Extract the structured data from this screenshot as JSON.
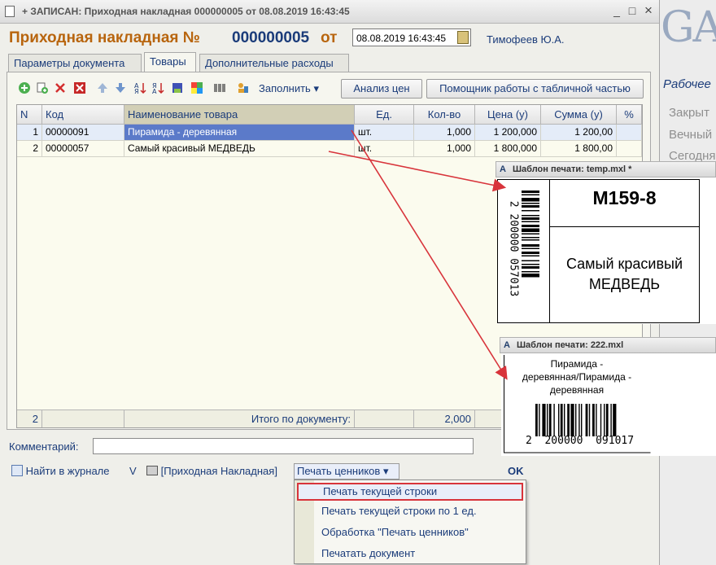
{
  "window": {
    "title": "+ ЗАПИСАН: Приходная накладная 000000005 от 08.08.2019 16:43:45",
    "minimize": "_",
    "maximize": "□",
    "close": "×"
  },
  "header": {
    "form_title": "Приходная накладная №",
    "number": "000000005",
    "from_label": "от",
    "date": "08.08.2019 16:43:45",
    "author": "Тимофеев Ю.А."
  },
  "tabs": [
    {
      "label": "Параметры документа",
      "active": false
    },
    {
      "label": "Товары",
      "active": true
    },
    {
      "label": "Дополнительные расходы",
      "active": false
    }
  ],
  "toolbar": {
    "fill_label": "Заполнить",
    "price_analysis_label": "Анализ цен",
    "table_helper_label": "Помощник работы с табличной частью",
    "icons": [
      "add-icon",
      "copy-icon",
      "delete-icon",
      "mark-delete-icon",
      "move-up-icon",
      "move-down-icon",
      "sort-asc-icon",
      "sort-desc-icon",
      "save-icon",
      "color-icon",
      "barcode-icon",
      "selection-icon"
    ]
  },
  "table": {
    "columns": [
      "N",
      "Код",
      "Наименование товара",
      "Ед.",
      "Кол-во",
      "Цена (у)",
      "Сумма (у)",
      "%"
    ],
    "rows": [
      {
        "n": "1",
        "code": "00000091",
        "name": "Пирамида - деревянная",
        "unit": "шт.",
        "qty": "1,000",
        "price": "1 200,000",
        "sum": "1 200,00",
        "pct": ""
      },
      {
        "n": "2",
        "code": "00000057",
        "name": "Самый красивый МЕДВЕДЬ",
        "unit": "шт.",
        "qty": "1,000",
        "price": "1 800,000",
        "sum": "1 800,00",
        "pct": ""
      }
    ],
    "footer": {
      "count": "2",
      "total_label": "Итого по документу:",
      "total_qty": "2,000"
    }
  },
  "comment": {
    "label": "Комментарий:",
    "value": ""
  },
  "bottom": {
    "journal_link": "Найти в журнале",
    "v_label": "V",
    "print_doc_link": "[Приходная Накладная]",
    "price_tags_menu": "Печать ценников",
    "ok_label": "OK"
  },
  "dropdown": {
    "items": [
      {
        "label": "Печать текущей строки",
        "highlighted": true
      },
      {
        "label": "Печать текущей строки по 1 ед.",
        "highlighted": false
      },
      {
        "label": "Обработка \"Печать ценников\"",
        "highlighted": false
      },
      {
        "label": "Печатать документ",
        "highlighted": false
      }
    ]
  },
  "template1": {
    "title": "Шаблон печати: temp.mxl *",
    "article": "М159-8",
    "name_line1": "Самый красивый",
    "name_line2": "МЕДВЕДЬ",
    "barcode_text": "2 200000 057013"
  },
  "template2": {
    "title": "Шаблон печати: 222.mxl",
    "name_line1": "Пирамида -",
    "name_line2": "деревянная/Пирамида -",
    "name_line3": "деревянная",
    "barcode_text": "2  200000  091017"
  },
  "background_app": {
    "logo_text": "GA",
    "work_label": "Рабочее",
    "items": [
      "Закрыт",
      "Вечный",
      "Сегодня"
    ]
  },
  "colors": {
    "accent_orange": "#b8650e",
    "accent_blue": "#1b3c7a",
    "selection": "#5b7ac9",
    "annotation_arrow": "#d8343b"
  }
}
